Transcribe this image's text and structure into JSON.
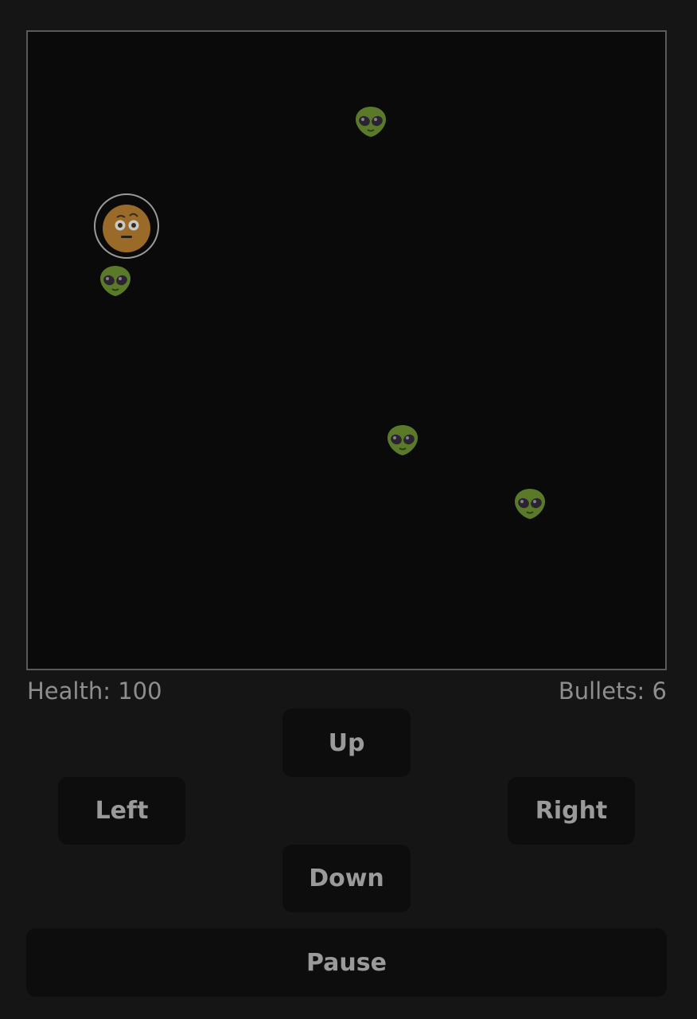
{
  "game": {
    "player_icon": "astronaut-face-icon",
    "enemy_icon": "alien-icon",
    "enemy_count": 4
  },
  "hud": {
    "health_label": "Health: 100",
    "bullets_label": "Bullets: 6"
  },
  "controls": {
    "up": "Up",
    "left": "Left",
    "right": "Right",
    "down": "Down",
    "pause": "Pause"
  },
  "colors": {
    "background": "#151515",
    "arena": "#0a0a0a",
    "arena_border": "#5a5a5a",
    "text": "#8e8e8e",
    "button_bg": "#0d0d0d",
    "alien_green": "#5a7a2a",
    "player_face": "#9a6a28"
  }
}
